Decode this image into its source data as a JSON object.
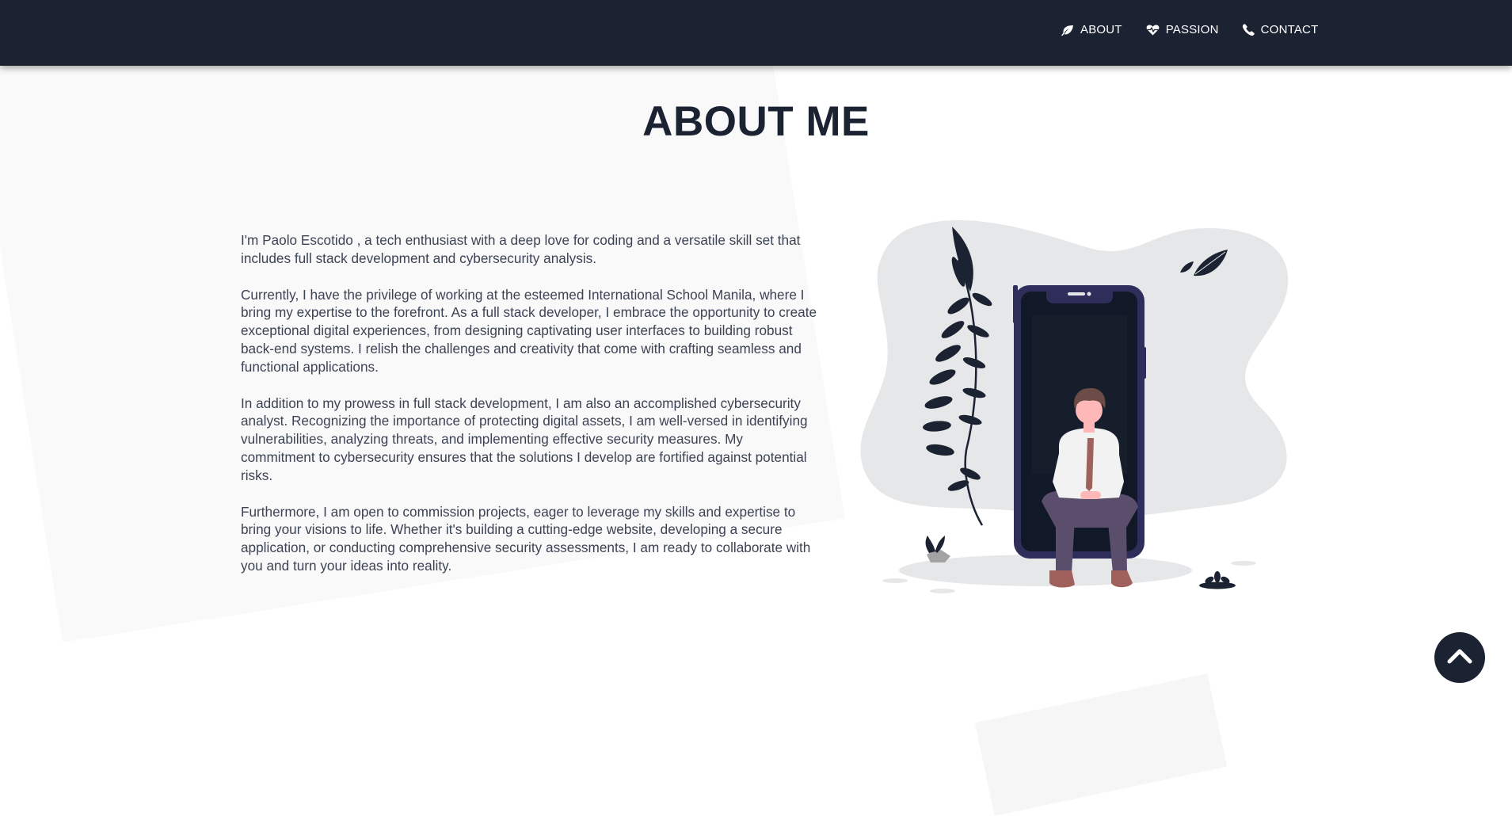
{
  "nav": {
    "items": [
      {
        "label": "ABOUT",
        "icon": "leaf-icon"
      },
      {
        "label": "PASSION",
        "icon": "heart-pulse-icon"
      },
      {
        "label": "CONTACT",
        "icon": "phone-icon"
      }
    ]
  },
  "main": {
    "title": "ABOUT ME",
    "paragraphs": [
      "I'm Paolo Escotido , a tech enthusiast with a deep love for coding and a versatile skill set that includes full stack development and cybersecurity analysis.",
      "Currently, I have the privilege of working at the esteemed International School Manila, where I bring my expertise to the forefront. As a full stack developer, I embrace the opportunity to create exceptional digital experiences, from designing captivating user interfaces to building robust back-end systems. I relish the challenges and creativity that come with crafting seamless and functional applications.",
      "In addition to my prowess in full stack development, I am also an accomplished cybersecurity analyst. Recognizing the importance of protecting digital assets, I am well-versed in identifying vulnerabilities, analyzing threats, and implementing effective security measures. My commitment to cybersecurity ensures that the solutions I develop are fortified against potential risks.",
      "Furthermore, I am open to commission projects, eager to leverage my skills and expertise to bring your visions to life. Whether it's building a cutting-edge website, developing a secure application, or conducting comprehensive security assessments, I am ready to collaborate with you and turn your ideas into reality."
    ]
  },
  "scroll_top": {
    "icon": "chevron-up-icon"
  },
  "colors": {
    "navbar": "#1b2232",
    "accent": "#2f2e5b",
    "text": "#3c4354",
    "blob": "#e6e7e9"
  }
}
